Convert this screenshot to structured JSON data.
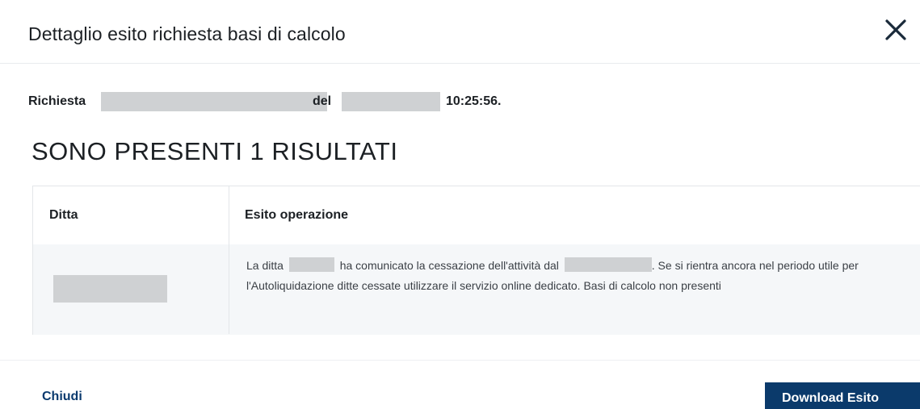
{
  "modal": {
    "title": "Dettaglio esito richiesta basi di calcolo",
    "close_icon": "close-icon"
  },
  "request": {
    "label": "Richiesta",
    "del_label": "del",
    "time": "10:25:56."
  },
  "results": {
    "heading": "SONO PRESENTI 1 RISULTATI"
  },
  "table": {
    "columns": [
      "Ditta",
      "Esito operazione"
    ],
    "rows": [
      {
        "esito_part1": "La ditta",
        "esito_part2": "ha comunicato la cessazione dell'attività dal",
        "esito_part3": ". Se si rientra ancora nel periodo utile per l'Autoliquidazione ditte cessate utilizzare il servizio online dedicato. Basi di calcolo non presenti"
      }
    ]
  },
  "footer": {
    "close_label": "Chiudi",
    "download_label": "Download Esito"
  },
  "colors": {
    "primary": "#0b3a6b",
    "redaction": "#cfd1d3",
    "row_bg": "#f5f7f9"
  }
}
